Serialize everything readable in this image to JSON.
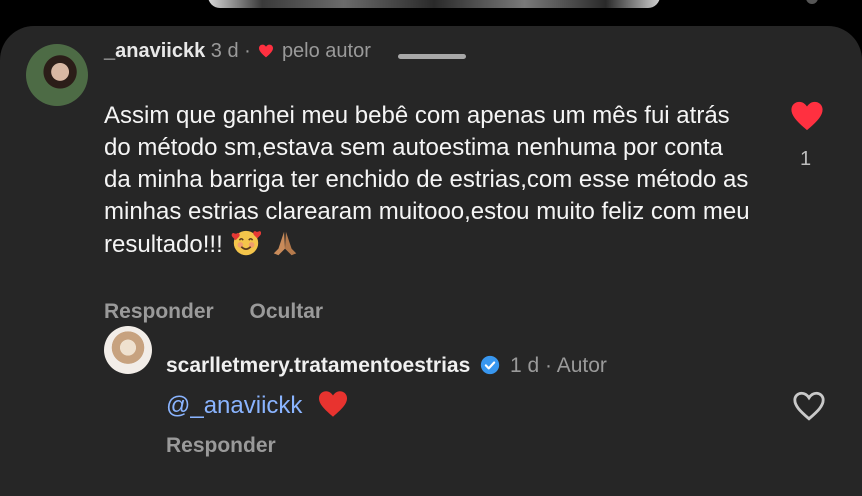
{
  "comment": {
    "username": "_anaviickk",
    "time": "3 d",
    "separator": "·",
    "author_badge": "pelo autor",
    "text": "Assim que ganhei meu bebê com apenas um mês fui atrás do método sm,estava sem autoestima nenhuma por conta da minha barriga ter enchido de estrias,com esse método as minhas estrias clarearam muitooo,estou muito feliz com meu resultado!!!",
    "emojis": [
      "smiling-face-with-hearts-emoji",
      "folded-hands-emoji"
    ],
    "likes": "1",
    "actions": {
      "reply": "Responder",
      "hide": "Ocultar"
    },
    "liked": true
  },
  "reply": {
    "username": "scarlletmery.tratamentoestrias",
    "verified": true,
    "time": "1 d",
    "separator": "·",
    "role": "Autor",
    "mention": "@_anaviickk",
    "actions": {
      "reply": "Responder"
    },
    "liked": false
  },
  "colors": {
    "sheet": "#262626",
    "like_red": "#ff3040",
    "mention_blue": "#8ab4ff",
    "verified_blue": "#3897f0"
  }
}
